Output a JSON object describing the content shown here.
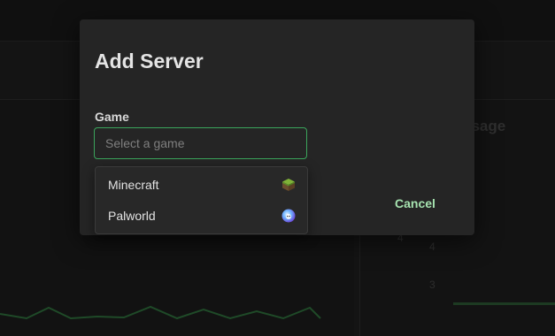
{
  "background": {
    "panel_title": "y Usage",
    "chart_ticks": [
      "4",
      "4",
      "3"
    ]
  },
  "modal": {
    "title": "Add Server",
    "game_field": {
      "label": "Game",
      "placeholder": "Select a game",
      "value": ""
    },
    "cancel_label": "Cancel"
  },
  "dropdown": {
    "options": [
      {
        "label": "Minecraft",
        "icon": "minecraft-grass-block-icon"
      },
      {
        "label": "Palworld",
        "icon": "palworld-icon"
      }
    ]
  },
  "colors": {
    "accent_green": "#3ba55c",
    "cancel_text": "#a6e3b0",
    "modal_bg": "#252525"
  }
}
